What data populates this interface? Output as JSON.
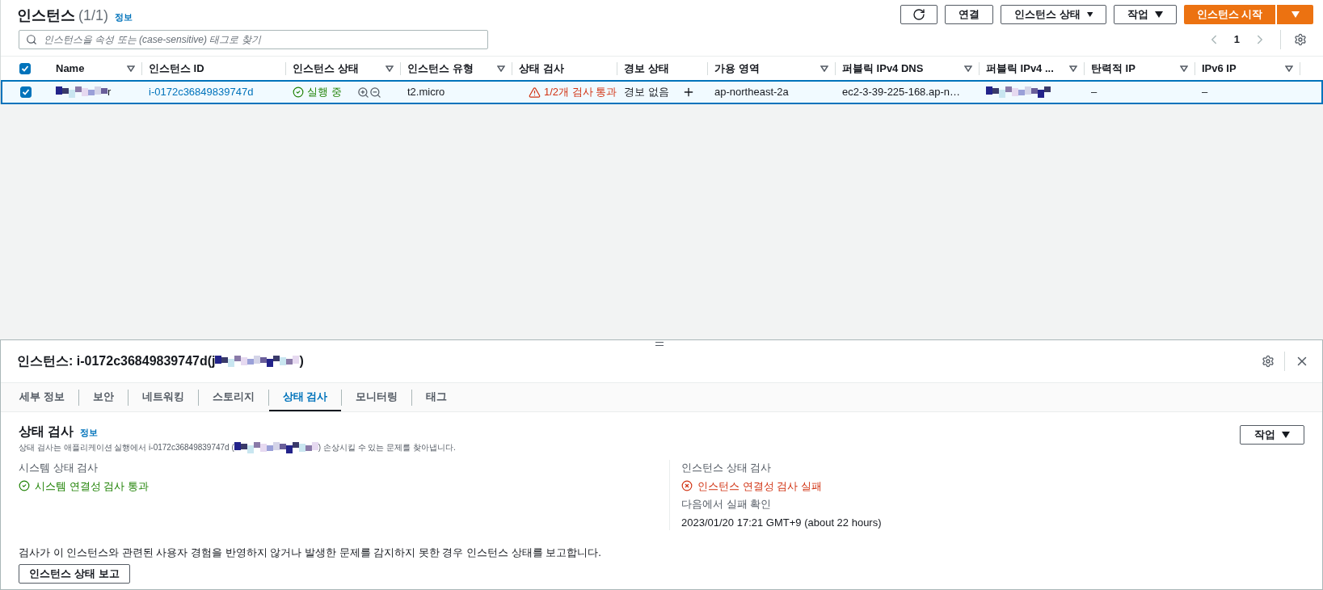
{
  "header": {
    "title": "인스턴스",
    "count": "(1/1)",
    "info": "정보"
  },
  "toolbar": {
    "connect": "연결",
    "state_menu": "인스턴스 상태",
    "actions": "작업",
    "launch": "인스턴스 시작"
  },
  "search": {
    "placeholder": "인스턴스을 속성 또는 (case-sensitive) 태그로 찾기"
  },
  "pagination": {
    "page": "1"
  },
  "table": {
    "all_checked": true,
    "columns": [
      {
        "label": "Name",
        "filter": true
      },
      {
        "label": "인스턴스 ID",
        "filter": false
      },
      {
        "label": "인스턴스 상태",
        "filter": true
      },
      {
        "label": "인스턴스 유형",
        "filter": true
      },
      {
        "label": "상태 검사",
        "filter": false
      },
      {
        "label": "경보 상태",
        "filter": false
      },
      {
        "label": "가용 영역",
        "filter": true
      },
      {
        "label": "퍼블릭 IPv4 DNS",
        "filter": true
      },
      {
        "label": "퍼블릭 IPv4 ...",
        "filter": true
      },
      {
        "label": "탄력적 IP",
        "filter": true
      },
      {
        "label": "IPv6 IP",
        "filter": true
      }
    ],
    "rows": [
      {
        "selected": true,
        "checked": true,
        "name_suffix": "r",
        "id": "i-0172c36849839747d",
        "state": "실행 중",
        "type": "t2.micro",
        "check": "1/2개 검사 통과",
        "alarm": "경보 없음",
        "az": "ap-northeast-2a",
        "dns": "ec2-3-39-225-168.ap-n…",
        "elastic_ip": "–",
        "ipv6": "–"
      }
    ]
  },
  "detail": {
    "title_prefix": "인스턴스: i-0172c36849839747d(j",
    "title_suffix": ")",
    "tabs": [
      {
        "label": "세부 정보",
        "selected": false
      },
      {
        "label": "보안",
        "selected": false
      },
      {
        "label": "네트워킹",
        "selected": false
      },
      {
        "label": "스토리지",
        "selected": false
      },
      {
        "label": "상태 검사",
        "selected": true
      },
      {
        "label": "모니터링",
        "selected": false
      },
      {
        "label": "태그",
        "selected": false
      }
    ],
    "section_title": "상태 검사",
    "info": "정보",
    "actions": "작업",
    "desc_prefix": "상태 검사는 애플리케이션 실행에서 i-0172c36849839747d (",
    "desc_suffix": ") 손상시킬 수 있는 문제를 찾아냅니다.",
    "checks": [
      {
        "label": "시스템 상태 검사",
        "result": "시스템 연결성 검사 통과",
        "passed": true
      },
      {
        "label": "인스턴스 상태 검사",
        "result": "인스턴스 연결성 검사 실패",
        "passed": false,
        "since_label": "다음에서 실패 확인",
        "since": "2023/01/20 17:21 GMT+9 (about 22 hours)"
      }
    ],
    "report_note": "검사가 이 인스턴스와 관련된 사용자 경험을 반영하지 않거나 발생한 문제를 감지하지 못한 경우 인스턴스 상태를 보고합니다.",
    "report_button": "인스턴스 상태 보고"
  }
}
